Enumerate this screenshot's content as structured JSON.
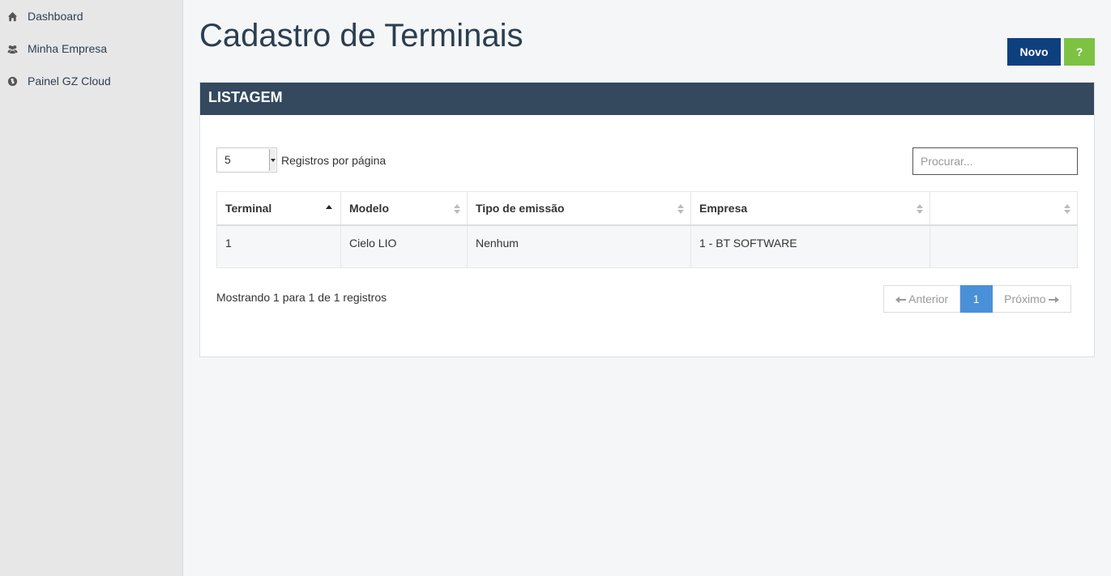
{
  "sidebar": {
    "items": [
      {
        "label": "Dashboard",
        "icon": "home-icon"
      },
      {
        "label": "Minha Empresa",
        "icon": "users-icon"
      },
      {
        "label": "Painel GZ Cloud",
        "icon": "globe-icon"
      }
    ]
  },
  "header": {
    "title": "Cadastro de Terminais",
    "new_button": "Novo",
    "help_button": "?"
  },
  "panel": {
    "title": "LISTAGEM",
    "page_length": "5",
    "page_length_label": "Registros por página",
    "search_placeholder": "Procurar..."
  },
  "table": {
    "columns": [
      "Terminal",
      "Modelo",
      "Tipo de emissão",
      "Empresa",
      ""
    ],
    "sorted_column": "Terminal",
    "sort_direction": "asc",
    "rows": [
      [
        "1",
        "Cielo LIO",
        "Nenhum",
        "1 - BT SOFTWARE",
        ""
      ]
    ]
  },
  "footer": {
    "info": "Mostrando 1 para 1 de 1 registros",
    "prev": "Anterior",
    "page": "1",
    "next": "Próximo"
  },
  "colors": {
    "panel_header": "#34495e",
    "new_button": "#0e3f7f",
    "help_button": "#7dc243",
    "active_page": "#4a90d9"
  }
}
